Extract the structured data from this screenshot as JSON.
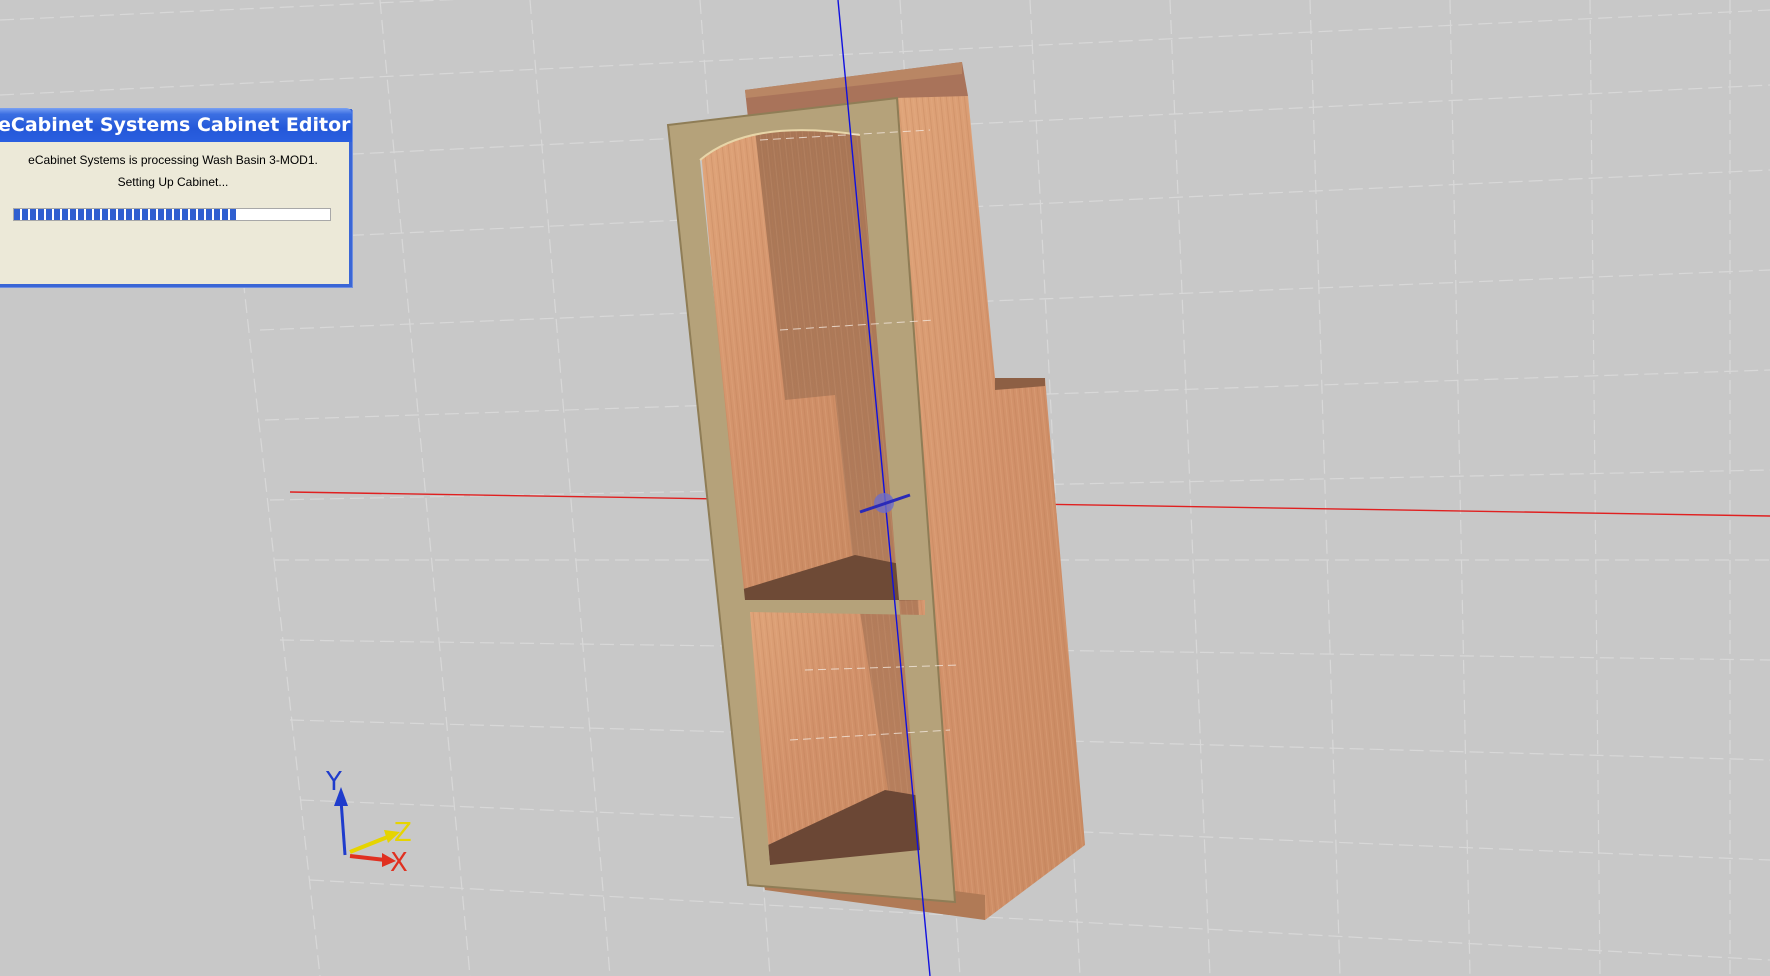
{
  "dialog": {
    "title": "eCabinet Systems Cabinet Editor",
    "message": "eCabinet Systems is processing Wash Basin 3-MOD1.",
    "status": "Setting Up Cabinet...",
    "progress_percent": 71
  },
  "axis_triad": {
    "y_label": "Y",
    "z_label": "Z",
    "x_label": "X"
  },
  "colors": {
    "background": "#c8c8c8",
    "x_axis": "#e02020",
    "y_axis": "#1010e0",
    "wood": "#d79a6e",
    "frame": "#b5a27a",
    "dialog_title": "#2458d9"
  }
}
